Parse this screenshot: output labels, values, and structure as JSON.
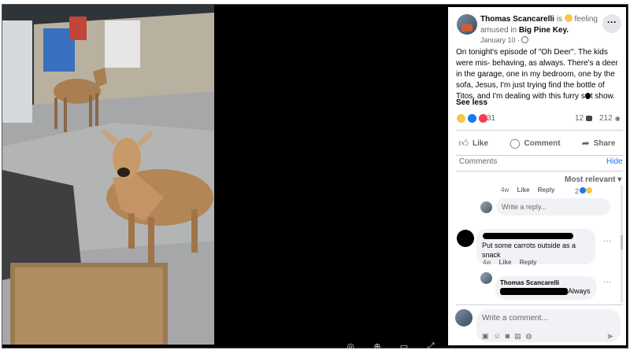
{
  "post": {
    "author_prefix": "Thomas Scancarelli",
    "feeling_text": "is",
    "feeling_word": "feeling amused in",
    "location": "Big Pine Key.",
    "date": "January 10 ·",
    "text_part1": "On tonight's episode of \"Oh Deer\". The kids were mis- behaving, as always. There's a deer in the garage, one in my bedroom, one by the sofa, Jesus, I'm just trying find the bottle of Titos, and I'm dealing with this furry s",
    "text_part2": "t show.",
    "see_less": "See less",
    "reaction_count": "31",
    "comment_count": "12",
    "share_count": "212"
  },
  "actions": {
    "like": "Like",
    "comment": "Comment",
    "share": "Share"
  },
  "comments_section": {
    "header": "Comments",
    "hide": "Hide",
    "sort": "Most relevant ▾",
    "prev_meta_time": "4w",
    "prev_meta_like": "Like",
    "prev_meta_reply": "Reply",
    "prev_react_count": "2",
    "reply_placeholder": "Write a reply...",
    "comment_text": "Put some carrots outside as a snack",
    "comment_time": "4w",
    "comment_like": "Like",
    "comment_reply": "Reply",
    "reply_author": "Thomas Scancarelli",
    "reply_tail": "Always",
    "write_placeholder": "Write a comment..."
  },
  "icons": {
    "more": "more-horizontal-icon",
    "like": "thumbs-up-icon",
    "comment": "speech-bubble-icon",
    "share": "share-arrow-icon",
    "send": "send-icon"
  },
  "colors": {
    "link_blue": "#1877f2",
    "muted_text": "#65676b",
    "bubble_bg": "#f0f2f5"
  }
}
